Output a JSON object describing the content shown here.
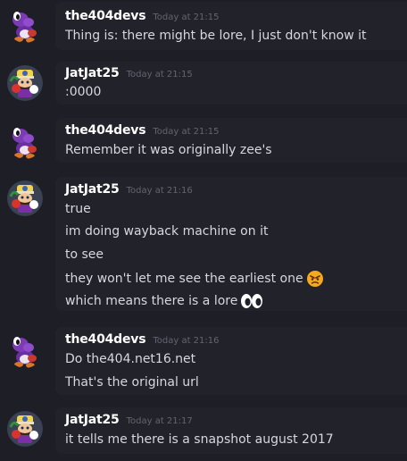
{
  "messages": [
    {
      "author": "the404devs",
      "timestamp": "Today at 21:15",
      "avatar": "purple-yoshi-avatar",
      "lines": [
        {
          "text": "Thing is: there might be lore, I just don't know it"
        }
      ]
    },
    {
      "author": "JatJat25",
      "timestamp": "Today at 21:15",
      "avatar": "wario-avatar",
      "lines": [
        {
          "text": ":0000"
        }
      ]
    },
    {
      "author": "the404devs",
      "timestamp": "Today at 21:15",
      "avatar": "purple-yoshi-avatar",
      "lines": [
        {
          "text": "Remember it was originally zee's"
        }
      ]
    },
    {
      "author": "JatJat25",
      "timestamp": "Today at 21:16",
      "avatar": "wario-avatar",
      "lines": [
        {
          "text": "true"
        },
        {
          "text": "im doing wayback machine on it"
        },
        {
          "text": "to see"
        },
        {
          "text": "they won't let me see the earliest one",
          "emoji": "angry-face-emoji"
        },
        {
          "text": "which means there is a lore",
          "emoji": "eyes-emoji"
        }
      ]
    },
    {
      "author": "the404devs",
      "timestamp": "Today at 21:16",
      "avatar": "purple-yoshi-avatar",
      "lines": [
        {
          "text": "Do the404.net16.net"
        },
        {
          "text": "That's the original url"
        }
      ]
    },
    {
      "author": "JatJat25",
      "timestamp": "Today at 21:17",
      "avatar": "wario-avatar",
      "lines": [
        {
          "text": "it tells me there is a snapshot august 2017"
        }
      ]
    }
  ],
  "colors": {
    "background": "#1e1e26",
    "username": "#ffffff",
    "timestamp": "#62656f",
    "message_text": "#d6d8dd"
  }
}
